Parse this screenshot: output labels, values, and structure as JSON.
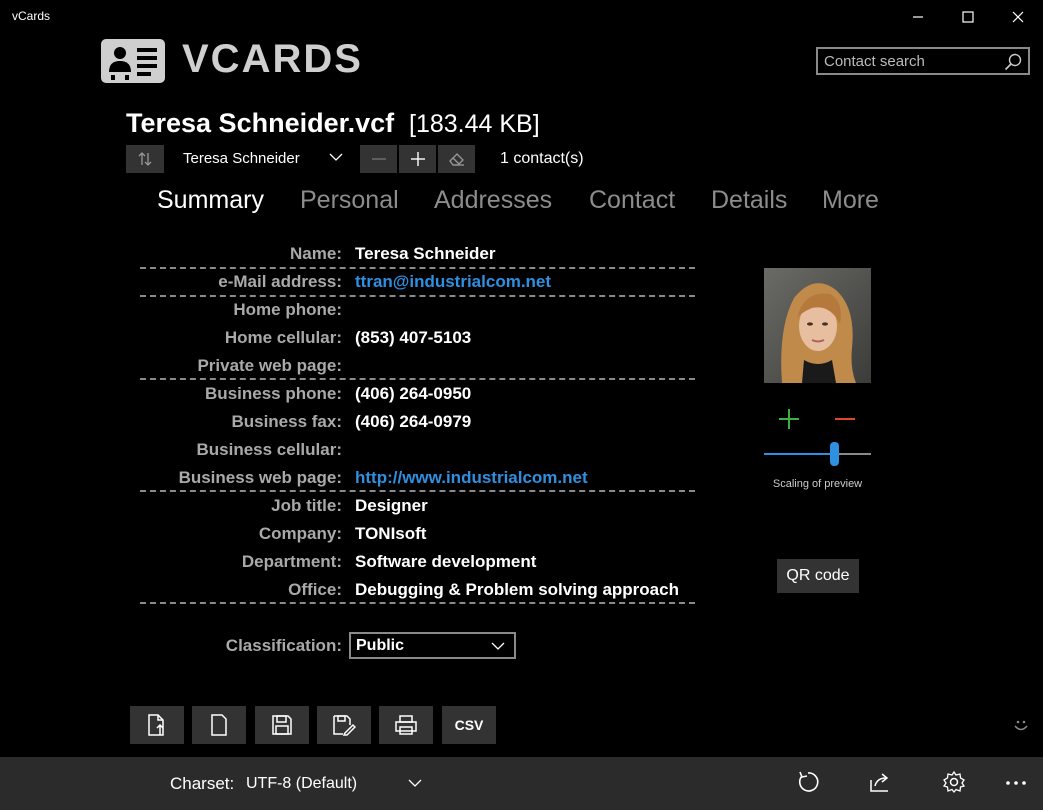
{
  "window": {
    "title": "vCards"
  },
  "logo": {
    "text": "VCARDS"
  },
  "search": {
    "placeholder": "Contact search"
  },
  "file": {
    "name": "Teresa Schneider.vcf",
    "size": "[183.44 KB]"
  },
  "contact_selector": {
    "selected": "Teresa Schneider",
    "count": "1 contact(s)"
  },
  "tabs": [
    {
      "label": "Summary",
      "active": true
    },
    {
      "label": "Personal",
      "active": false
    },
    {
      "label": "Addresses",
      "active": false
    },
    {
      "label": "Contact",
      "active": false
    },
    {
      "label": "Details",
      "active": false
    },
    {
      "label": "More",
      "active": false
    }
  ],
  "fields": [
    {
      "label": "Name:",
      "value": "Teresa Schneider"
    },
    {
      "label": "e-Mail address:",
      "value": "ttran@industrialcom.net"
    },
    {
      "label": "Home phone:",
      "value": ""
    },
    {
      "label": "Home cellular:",
      "value": "(853) 407-5103"
    },
    {
      "label": "Private web page:",
      "value": ""
    },
    {
      "label": "Business phone:",
      "value": "(406) 264-0950"
    },
    {
      "label": "Business fax:",
      "value": "(406) 264-0979"
    },
    {
      "label": "Business cellular:",
      "value": ""
    },
    {
      "label": "Business web page:",
      "value": "http://www.industrialcom.net"
    },
    {
      "label": "Job title:",
      "value": "Designer"
    },
    {
      "label": "Company:",
      "value": "TONIsoft"
    },
    {
      "label": "Department:",
      "value": "Software development"
    },
    {
      "label": "Office:",
      "value": "Debugging & Problem solving approach"
    }
  ],
  "preview": {
    "scale_caption": "Scaling of preview",
    "scale_level": 0.65,
    "qr_button": "QR code"
  },
  "classification": {
    "label": "Classification:",
    "value": "Public"
  },
  "toolbar": {
    "csv_label": "CSV"
  },
  "status_bar": {
    "charset_label": "Charset:",
    "charset_value": "UTF-8 (Default)"
  },
  "colors": {
    "background": "#000000",
    "panel": "#333333",
    "accent_link": "#2f8fe0",
    "plus_green": "#3cb043",
    "minus_red": "#e0452f",
    "label_gray": "#a9a9a9",
    "status_bar": "#2b2b2b"
  }
}
